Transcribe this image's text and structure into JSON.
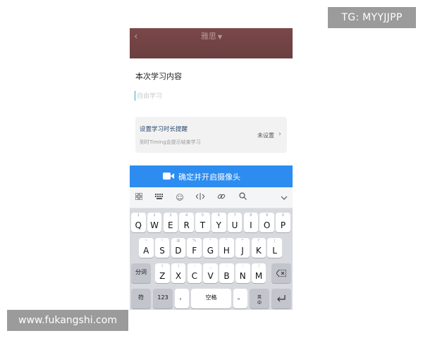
{
  "watermarks": {
    "tg": "TG: MYYJJPP",
    "site": "www.fukangshi.com"
  },
  "header": {
    "back_icon": "chevron-left-icon",
    "title": "雅思"
  },
  "study": {
    "section_title": "本次学习内容",
    "input_placeholder": "自由学习",
    "input_value": ""
  },
  "reminder": {
    "title": "设置学习时长提醒",
    "subtitle": "到时Timing会提示结束学习",
    "value": "未设置"
  },
  "camera_button": {
    "label": "确定并开启摄像头",
    "icon": "video-camera-icon"
  },
  "keyboard": {
    "toolbar_icons": [
      "grid-icon",
      "keyboard-icon",
      "emoji-icon",
      "cursor-icon",
      "link-icon",
      "search-icon",
      "collapse-icon"
    ],
    "row1": [
      {
        "key": "Q",
        "hint": "1"
      },
      {
        "key": "W",
        "hint": "2"
      },
      {
        "key": "E",
        "hint": "3"
      },
      {
        "key": "R",
        "hint": "4"
      },
      {
        "key": "T",
        "hint": "5"
      },
      {
        "key": "Y",
        "hint": "6"
      },
      {
        "key": "U",
        "hint": "7"
      },
      {
        "key": "I",
        "hint": "8"
      },
      {
        "key": "O",
        "hint": "9"
      },
      {
        "key": "P",
        "hint": "0"
      }
    ],
    "row2": [
      {
        "key": "A",
        "hint": "~"
      },
      {
        "key": "S",
        "hint": "!"
      },
      {
        "key": "D",
        "hint": "@"
      },
      {
        "key": "F",
        "hint": "%"
      },
      {
        "key": "G",
        "hint": "\""
      },
      {
        "key": "H",
        "hint": "\""
      },
      {
        "key": "J",
        "hint": "*"
      },
      {
        "key": "K",
        "hint": "?"
      },
      {
        "key": "L",
        "hint": "|"
      }
    ],
    "row3": [
      {
        "key": "Z",
        "hint": "("
      },
      {
        "key": "X",
        "hint": ")"
      },
      {
        "key": "C",
        "hint": "-"
      },
      {
        "key": "V",
        "hint": "_"
      },
      {
        "key": "B",
        "hint": ":"
      },
      {
        "key": "N",
        "hint": ";"
      },
      {
        "key": "M",
        "hint": "/"
      }
    ],
    "shift_label": "分词",
    "symbol_label": "符",
    "num_label": "123",
    "comma_label": "，",
    "space_label": "空格",
    "period_label": "。",
    "lang_label": "英\n中"
  }
}
